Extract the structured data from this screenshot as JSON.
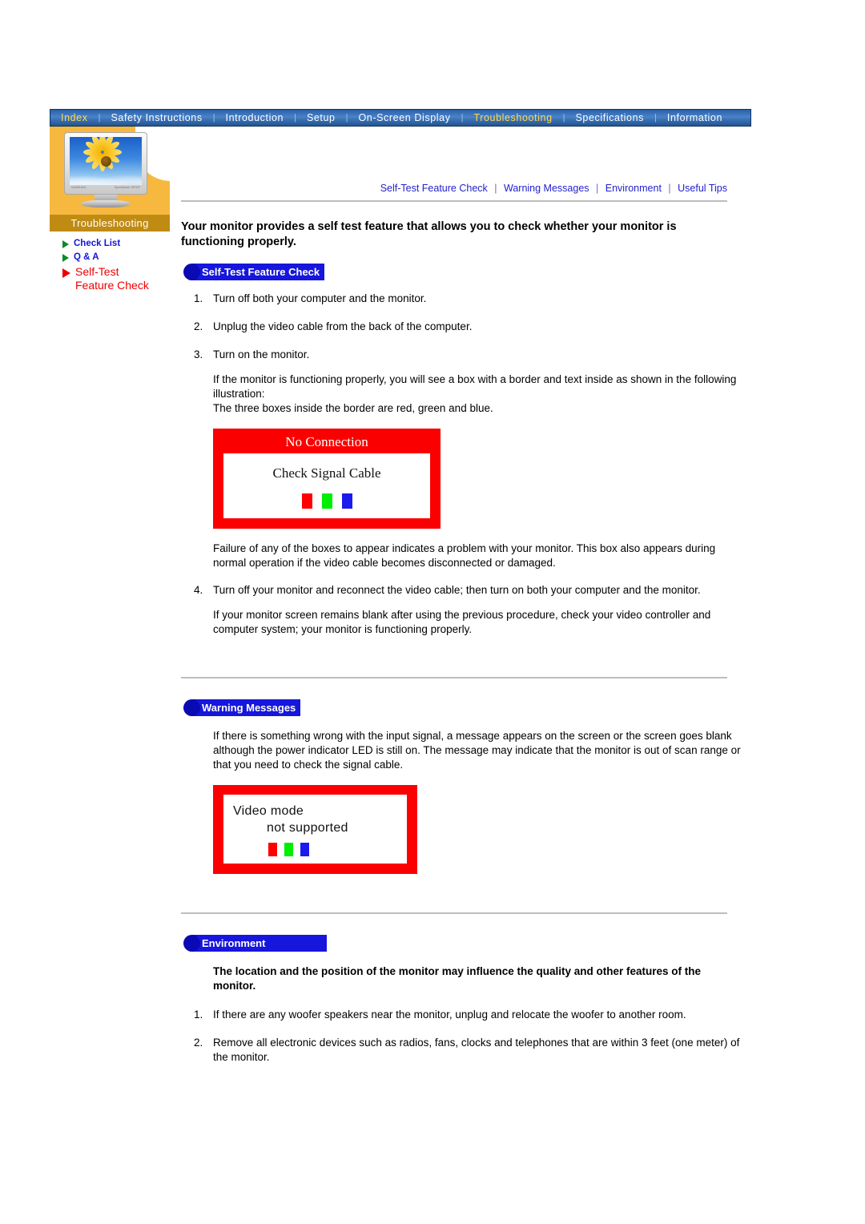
{
  "topnav": {
    "items": [
      {
        "label": "Index",
        "active": false
      },
      {
        "label": "Safety Instructions",
        "active": false
      },
      {
        "label": "Introduction",
        "active": false
      },
      {
        "label": "Setup",
        "active": false
      },
      {
        "label": "On-Screen Display",
        "active": false
      },
      {
        "label": "Troubleshooting",
        "active": true
      },
      {
        "label": "Specifications",
        "active": false
      },
      {
        "label": "Information",
        "active": false
      }
    ],
    "separator": "|",
    "active_color": "#ffd94a",
    "bar_color": "#3b72b8"
  },
  "sidebar": {
    "section_label": "Troubleshooting",
    "thumbnail": {
      "brand_text": "SAMSUNG",
      "model_text": "SyncMaster 997DF",
      "image_subject": "monitor-with-sunflower-wallpaper"
    },
    "items": [
      {
        "label": "Check List",
        "current": false,
        "marker_color": "#0a8a2a",
        "text_color": "#1414d2"
      },
      {
        "label": "Q & A",
        "current": false,
        "marker_color": "#0a8a2a",
        "text_color": "#1414d2"
      },
      {
        "label": "Self-Test\nFeature Check",
        "line1": "Self-Test",
        "line2": "Feature Check",
        "current": true,
        "marker_color": "#ef0000",
        "text_color": "#ee0000"
      }
    ]
  },
  "subnav": {
    "items": [
      "Self-Test Feature Check",
      "Warning Messages",
      "Environment",
      "Useful Tips"
    ],
    "separator": "|",
    "link_color": "#2222cc"
  },
  "main": {
    "lead": "Your monitor provides a self test feature that allows you to check whether your monitor is functioning properly.",
    "sections": {
      "self_test": {
        "badge": "Self-Test Feature Check",
        "steps": [
          "Turn off both your computer and the monitor.",
          "Unplug the video cable from the back of the computer.",
          "Turn on the monitor."
        ],
        "after_step3_a": "If the monitor is functioning properly, you will see a box with a border and text inside as shown in the following illustration:",
        "after_step3_b": "The three boxes inside the border are red, green and blue.",
        "illustration": {
          "caption": "No Connection",
          "message": "Check Signal Cable",
          "swatches": [
            "#ff0000",
            "#00ee00",
            "#1a1aee"
          ],
          "border_color": "#fb0000"
        },
        "after_illustration": "Failure of any of the boxes to appear indicates a problem with your monitor. This box also appears during normal operation if the video cable becomes disconnected or damaged.",
        "step4": "Turn off your monitor and reconnect the video cable; then turn on both your computer and the monitor.",
        "closing": "If your monitor screen remains blank after using the previous procedure, check your video controller and computer system; your monitor is functioning properly."
      },
      "warning_messages": {
        "badge": "Warning Messages",
        "body": "If there is something wrong with the input signal, a message appears on the screen or the screen goes blank although the power indicator LED is still on. The message may indicate that the monitor is out of scan range or that you need to check the signal cable.",
        "illustration": {
          "message_line1": "Video mode",
          "message_line2": "not  supported",
          "swatches": [
            "#ff0000",
            "#00ee00",
            "#1a1aee"
          ],
          "border_color": "#fb0000"
        }
      },
      "environment": {
        "badge": "Environment",
        "heading": "The location and the position of the monitor may influence the quality and other features of the monitor.",
        "items": [
          "If there are any woofer speakers near the monitor, unplug and relocate the woofer to another room.",
          "Remove all electronic devices such as radios, fans, clocks and telephones that are within 3 feet (one meter) of the monitor."
        ]
      }
    }
  }
}
